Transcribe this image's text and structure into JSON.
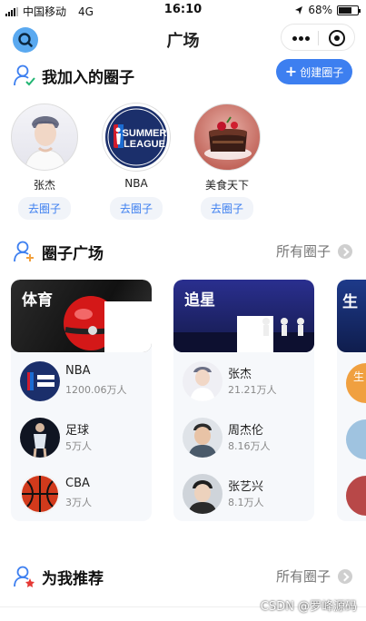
{
  "status_bar": {
    "carrier": "中国移动",
    "network": "4G",
    "time": "16:10",
    "battery": "68%",
    "battery_level": 0.68
  },
  "nav": {
    "title": "广场"
  },
  "my_circles": {
    "title": "我加入的圈子",
    "create_label": "创建圈子",
    "create_icon": "+",
    "goto_label": "去圈子",
    "items": [
      {
        "name": "张杰"
      },
      {
        "name": "NBA",
        "logo_lines": [
          "SUMMER",
          "LEAGUE"
        ]
      },
      {
        "name": "美食天下"
      }
    ]
  },
  "plaza": {
    "title": "圈子广场",
    "more_label": "所有圈子",
    "cards": [
      {
        "title": "体育",
        "items": [
          {
            "name": "NBA",
            "count": "1200.06万人"
          },
          {
            "name": "足球",
            "count": "5万人"
          },
          {
            "name": "CBA",
            "count": "3万人"
          }
        ]
      },
      {
        "title": "追星",
        "items": [
          {
            "name": "张杰",
            "count": "21.21万人"
          },
          {
            "name": "周杰伦",
            "count": "8.16万人"
          },
          {
            "name": "张艺兴",
            "count": "8.1万人"
          }
        ]
      },
      {
        "title": "生",
        "items": [
          {
            "name": "生"
          },
          {
            "name": ""
          },
          {
            "name": ""
          }
        ]
      }
    ]
  },
  "recommend": {
    "title": "为我推荐",
    "more_label": "所有圈子"
  },
  "watermark": "CSDN @罗峰源码",
  "colors": {
    "accent": "#3d7ff0",
    "search_bg": "#5aa9f0"
  }
}
